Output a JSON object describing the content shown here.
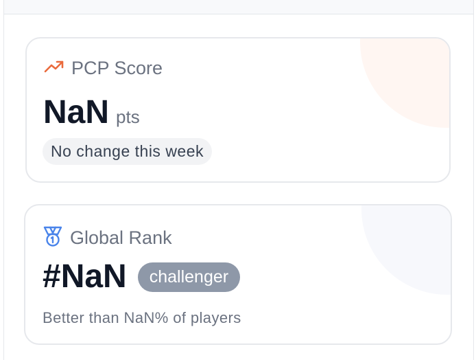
{
  "colors": {
    "accent_orange": "#ea6a3c",
    "accent_blue": "#4a84ea",
    "badge_gray": "#8e98a8"
  },
  "score_card": {
    "icon": "trending-up-icon",
    "label": "PCP Score",
    "value": "NaN",
    "unit": "pts",
    "change_text": "No change this week"
  },
  "rank_card": {
    "icon": "medal-icon",
    "label": "Global Rank",
    "value": "#NaN",
    "tier": "challenger",
    "percentile_text": "Better than NaN% of players"
  }
}
